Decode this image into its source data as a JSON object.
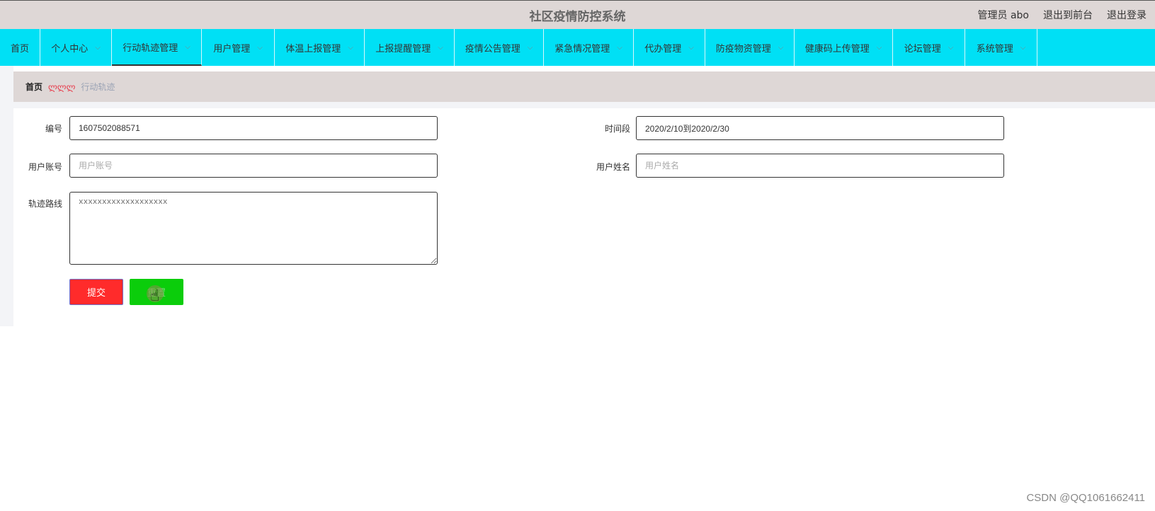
{
  "header": {
    "title": "社区疫情防控系统",
    "user_label": "管理员 abo",
    "to_front": "退出到前台",
    "logout": "退出登录"
  },
  "nav": {
    "items": [
      {
        "label": "首页",
        "dropdown": false
      },
      {
        "label": "个人中心",
        "dropdown": true
      },
      {
        "label": "行动轨迹管理",
        "dropdown": true,
        "active": true
      },
      {
        "label": "用户管理",
        "dropdown": true
      },
      {
        "label": "体温上报管理",
        "dropdown": true
      },
      {
        "label": "上报提醒管理",
        "dropdown": true
      },
      {
        "label": "疫情公告管理",
        "dropdown": true
      },
      {
        "label": "紧急情况管理",
        "dropdown": true
      },
      {
        "label": "代办管理",
        "dropdown": true
      },
      {
        "label": "防疫物资管理",
        "dropdown": true
      },
      {
        "label": "健康码上传管理",
        "dropdown": true
      },
      {
        "label": "论坛管理",
        "dropdown": true
      },
      {
        "label": "系统管理",
        "dropdown": true
      }
    ],
    "chevron": "⌵"
  },
  "breadcrumb": {
    "home": "首页",
    "separator": "ლლლ",
    "current": "行动轨迹"
  },
  "form": {
    "id": {
      "label": "编号",
      "value": "1607502088571"
    },
    "period": {
      "label": "时间段",
      "value": "2020/2/10到2020/2/30"
    },
    "account": {
      "label": "用户账号",
      "placeholder": "用户账号"
    },
    "name": {
      "label": "用户姓名",
      "placeholder": "用户姓名"
    },
    "route": {
      "label": "轨迹路线",
      "value": "xxxxxxxxxxxxxxxxxxx"
    },
    "submit": "提交",
    "reset": "重置"
  },
  "watermark": "CSDN @QQ1061662411",
  "colors": {
    "nav_bg": "#00e0f5",
    "header_bg": "#ded7d6",
    "submit_bg": "#ff2b2b",
    "reset_bg": "#0bcd0b"
  }
}
